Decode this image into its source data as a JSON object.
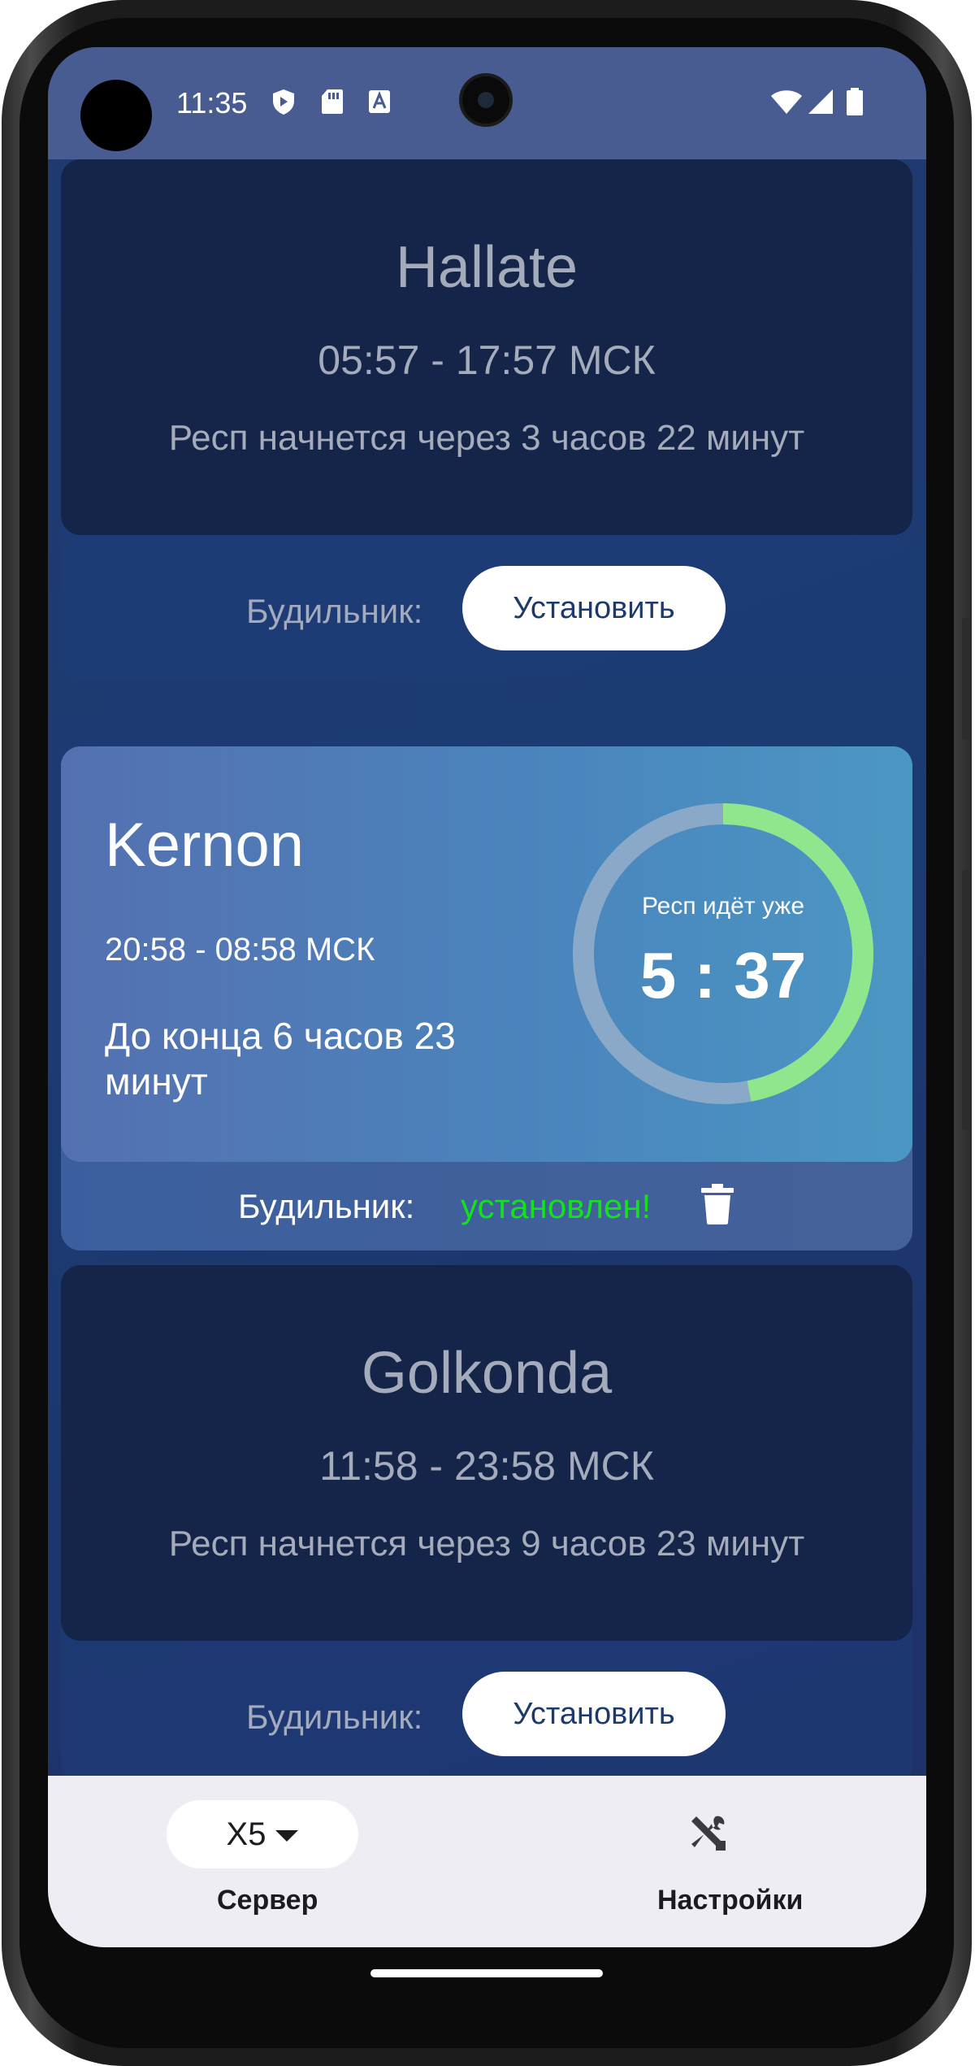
{
  "status_bar": {
    "time": "11:35"
  },
  "servers": [
    {
      "name": "Hallate",
      "hours": "05:57 - 17:57 МСК",
      "status": "Респ начнется через 3 часов 22 минут",
      "alarm_label": "Будильник:",
      "alarm_button": "Установить"
    },
    {
      "name": "Kernon",
      "hours": "20:58 - 08:58 МСК",
      "status": "До конца 6 часов 23 минут",
      "progress_label": "Респ идёт уже",
      "progress_time": "5 : 37",
      "progress_fraction": 0.47,
      "alarm_label": "Будильник:",
      "alarm_status": "установлен!",
      "alarm_status_color": "#14e01e"
    },
    {
      "name": "Golkonda",
      "hours": "11:58 - 23:58 МСК",
      "status": "Респ начнется через 9 часов 23 минут",
      "alarm_label": "Будильник:",
      "alarm_button": "Установить"
    }
  ],
  "bottom_nav": {
    "server_value": "X5",
    "server_label": "Сервер",
    "settings_label": "Настройки",
    "settings_icon": "tools-icon"
  },
  "colors": {
    "status_bar": "#485c92",
    "progress_ring": "#8fe68c"
  }
}
